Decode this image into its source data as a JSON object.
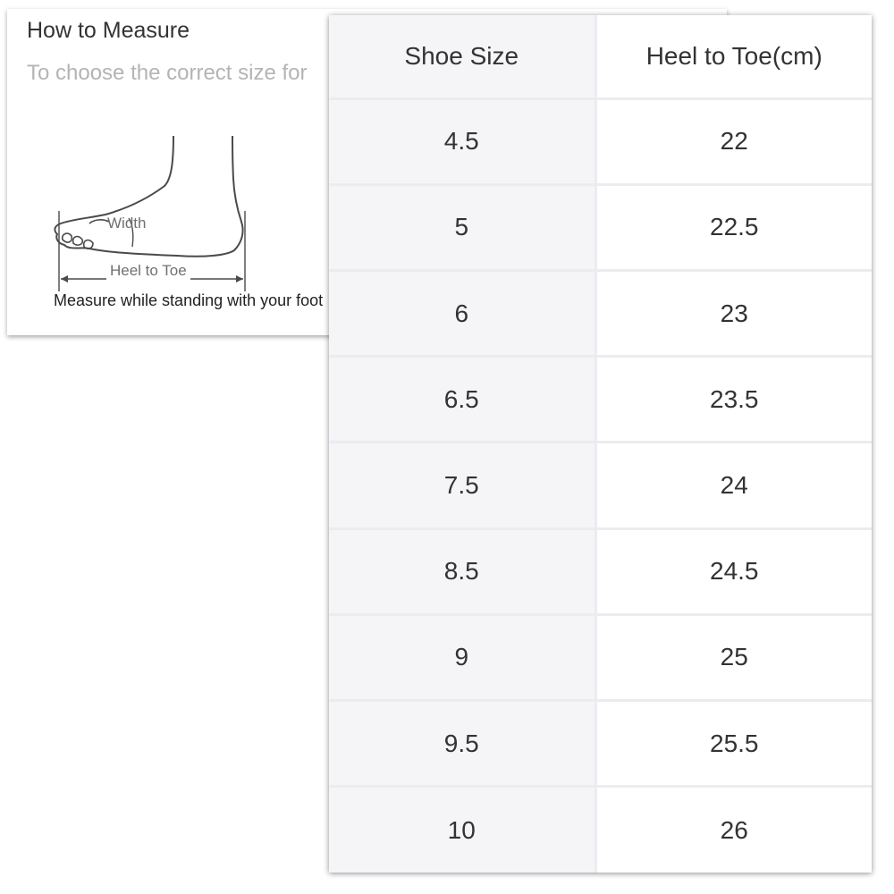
{
  "measure": {
    "title": "How to Measure",
    "subtitle": "To choose the correct size for",
    "width_label": "Width",
    "heel_to_toe_label": "Heel to Toe",
    "note": "Measure while standing with your foot"
  },
  "size_table": {
    "headers": {
      "shoe_size": "Shoe Size",
      "heel_to_toe": "Heel to Toe(cm)"
    },
    "rows": [
      {
        "size": "4.5",
        "cm": "22"
      },
      {
        "size": "5",
        "cm": "22.5"
      },
      {
        "size": "6",
        "cm": "23"
      },
      {
        "size": "6.5",
        "cm": "23.5"
      },
      {
        "size": "7.5",
        "cm": "24"
      },
      {
        "size": "8.5",
        "cm": "24.5"
      },
      {
        "size": "9",
        "cm": "25"
      },
      {
        "size": "9.5",
        "cm": "25.5"
      },
      {
        "size": "10",
        "cm": "26"
      }
    ]
  }
}
